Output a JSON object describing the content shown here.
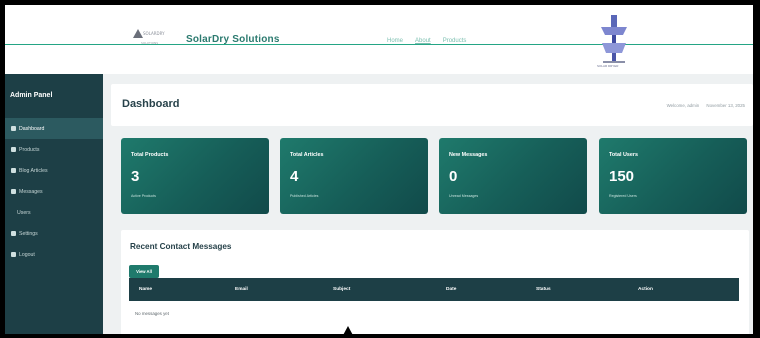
{
  "topbar": {
    "logo_text": "SOLARDRY",
    "logo_subtext": "SOLUTIONS",
    "brand": "SolarDry Solutions",
    "nav": [
      {
        "label": "Home"
      },
      {
        "label": "About"
      },
      {
        "label": "Products"
      }
    ],
    "tower_caption": "SOLAR DRYER"
  },
  "sidebar": {
    "title": "Admin Panel",
    "items": [
      {
        "label": "Dashboard",
        "icon": "dashboard-icon",
        "active": true
      },
      {
        "label": "Products",
        "icon": "box-icon"
      },
      {
        "label": "Blog Articles",
        "icon": "article-icon"
      },
      {
        "label": "Messages",
        "icon": "envelope-icon"
      },
      {
        "label": "Users",
        "icon": ""
      },
      {
        "label": "Settings",
        "icon": "gear-icon"
      },
      {
        "label": "Logout",
        "icon": "logout-icon"
      }
    ]
  },
  "main": {
    "title": "Dashboard",
    "welcome": "Welcome, admin",
    "date": "November 13, 2025",
    "cards": [
      {
        "title": "Total Products",
        "value": "3",
        "sub": "Active Products"
      },
      {
        "title": "Total Articles",
        "value": "4",
        "sub": "Published Articles"
      },
      {
        "title": "New Messages",
        "value": "0",
        "sub": "Unread Messages"
      },
      {
        "title": "Total Users",
        "value": "150",
        "sub": "Registered Users"
      }
    ],
    "recent": {
      "title": "Recent Contact Messages",
      "view_all": "View All",
      "columns": [
        "Name",
        "Email",
        "Subject",
        "Date",
        "Status",
        "Action"
      ],
      "empty": "No messages yet"
    }
  },
  "colors": {
    "accent": "#1f7a6c",
    "sidebar_bg": "#1d3f46",
    "brand_text": "#2b7a6f",
    "accent_line": "#24a585"
  }
}
